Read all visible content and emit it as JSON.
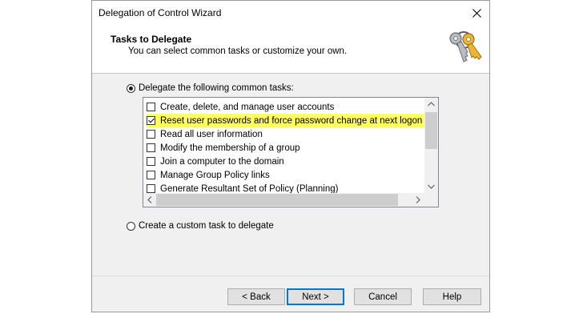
{
  "window": {
    "title": "Delegation of Control Wizard"
  },
  "header": {
    "title": "Tasks to Delegate",
    "subtitle": "You can select common tasks or customize your own.",
    "icon": "keys-icon"
  },
  "options": {
    "common": {
      "label": "Delegate the following common tasks:",
      "selected": true
    },
    "custom": {
      "label": "Create a custom task to delegate",
      "selected": false
    }
  },
  "tasks": [
    {
      "label": "Create, delete, and manage user accounts",
      "checked": false
    },
    {
      "label": "Reset user passwords and force password change at next logon",
      "checked": true,
      "highlight": "#ffff66"
    },
    {
      "label": "Read all user information",
      "checked": false
    },
    {
      "label": "Modify the membership of a group",
      "checked": false
    },
    {
      "label": "Join a computer to the domain",
      "checked": false
    },
    {
      "label": "Manage Group Policy links",
      "checked": false
    },
    {
      "label": "Generate Resultant Set of Policy (Planning)",
      "checked": false
    }
  ],
  "buttons": {
    "back": "< Back",
    "next": "Next >",
    "cancel": "Cancel",
    "help": "Help"
  },
  "colors": {
    "highlight": "#ffff66",
    "default_button_border": "#0078d7"
  }
}
